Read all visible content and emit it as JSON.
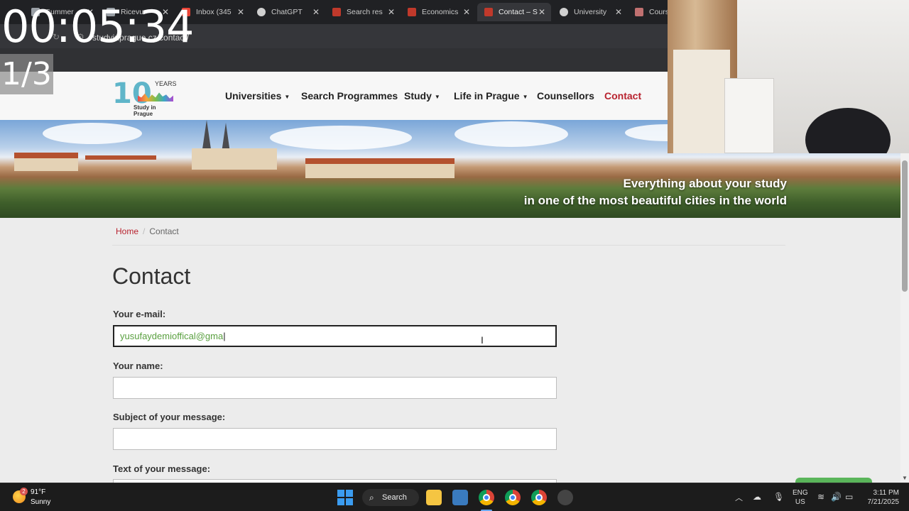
{
  "browser": {
    "tabs": [
      {
        "label": "Summer",
        "favicon_color": "#9aa0a6"
      },
      {
        "label": "Ricevu",
        "favicon_color": "#9aa0a6"
      },
      {
        "label": "Inbox (345",
        "favicon_color": "#ea4335"
      },
      {
        "label": "ChatGPT",
        "favicon_color": "#d0d0d0"
      },
      {
        "label": "Search res",
        "favicon_color": "#c0392b"
      },
      {
        "label": "Economics",
        "favicon_color": "#c0392b"
      },
      {
        "label": "Contact – S",
        "favicon_color": "#c0392b"
      },
      {
        "label": "University",
        "favicon_color": "#d0d0d0"
      },
      {
        "label": "Course",
        "favicon_color": "#c07070"
      }
    ],
    "active_tab_index": 6,
    "url": "studyinprague.cz/contact/"
  },
  "overlay": {
    "timer": "00:05:34",
    "counter": "1/3"
  },
  "site": {
    "logo": {
      "ten": "10",
      "years": "YEARS",
      "tagline": "Study in Prague"
    },
    "nav": [
      {
        "label": "Universities",
        "dropdown": true
      },
      {
        "label": "Search Programmes",
        "dropdown": false
      },
      {
        "label": "Study",
        "dropdown": true
      },
      {
        "label": "Life in Prague",
        "dropdown": true
      },
      {
        "label": "Counsellors",
        "dropdown": false
      },
      {
        "label": "Contact",
        "dropdown": false,
        "active": true
      }
    ],
    "banner": {
      "line1": "Everything about your study",
      "line2": "in one of the most beautiful cities in the world"
    },
    "breadcrumb": {
      "home": "Home",
      "current": "Contact"
    },
    "page_title": "Contact",
    "form": {
      "email_label": "Your e-mail:",
      "email_value": "yusufaydemioffical@gma",
      "name_label": "Your name:",
      "name_value": "",
      "subject_label": "Subject of your message:",
      "subject_value": "",
      "message_label": "Text of your message:"
    },
    "accent_color": "#b8232f"
  },
  "taskbar": {
    "weather_badge": "2",
    "temperature": "91°F",
    "condition": "Sunny",
    "search_label": "Search",
    "lang_line1": "ENG",
    "lang_line2": "US",
    "time": "3:11 PM",
    "date": "7/21/2025"
  }
}
